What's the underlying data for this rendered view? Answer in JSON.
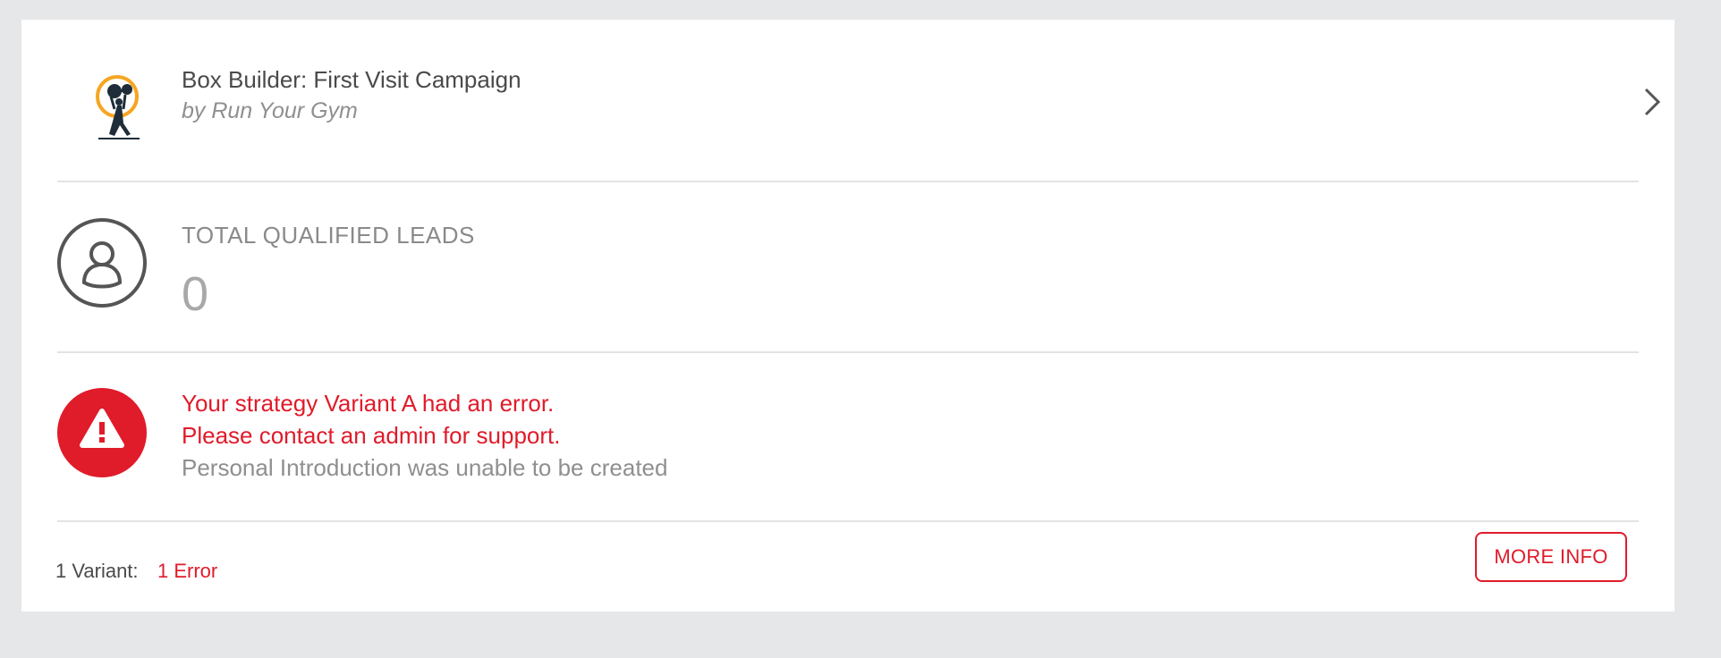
{
  "campaign": {
    "title": "Box Builder: First Visit Campaign",
    "author": "by Run Your Gym",
    "logo_icon": "weightlifter-logo-icon",
    "open_icon": "chevron-right-icon"
  },
  "leads": {
    "label": "TOTAL QUALIFIED LEADS",
    "value": "0",
    "icon": "user-icon"
  },
  "error": {
    "icon": "warning-icon",
    "line1": "Your strategy Variant A had an error.",
    "line2": "Please contact an admin for support.",
    "detail": "Personal Introduction was unable to be created"
  },
  "footer": {
    "variant_label": "1 Variant:",
    "error_count": "1 Error",
    "more_info_label": "MORE INFO"
  },
  "colors": {
    "accent_red": "#e01b2a",
    "background": "#e6e7e8",
    "logo_orange": "#f5a623"
  }
}
